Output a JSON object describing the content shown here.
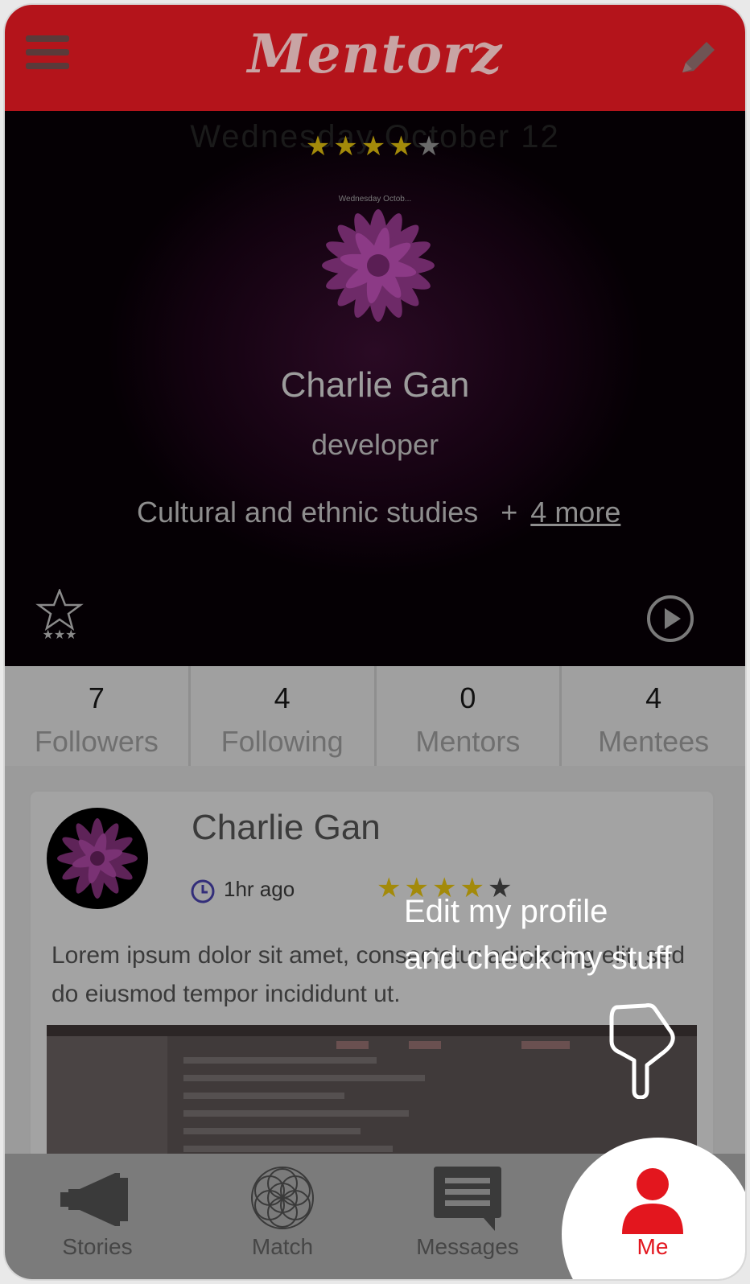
{
  "header": {
    "app_title": "Mentorz"
  },
  "hero": {
    "date_ghost": "Wednesday October 12",
    "stars": [
      "★",
      "★",
      "★",
      "★",
      "★"
    ],
    "avatar_caption": "Wednesday Octob...",
    "name": "Charlie Gan",
    "role": "developer",
    "interest": "Cultural and ethnic studies",
    "more_prefix": "+",
    "more_link": "4 more"
  },
  "stats": [
    {
      "value": "7",
      "label": "Followers"
    },
    {
      "value": "4",
      "label": "Following"
    },
    {
      "value": "0",
      "label": "Mentors"
    },
    {
      "value": "4",
      "label": "Mentees"
    }
  ],
  "post": {
    "author": "Charlie Gan",
    "time": "1hr ago",
    "rating_stars": 4,
    "stars": [
      "★",
      "★",
      "★",
      "★",
      "★"
    ],
    "text": "Lorem ipsum dolor sit amet, consectetur adipiscing elit, sed do eiusmod tempor incididunt ut."
  },
  "tutorial": {
    "line1": "Edit my profile",
    "line2": "and check my stuff"
  },
  "tabs": [
    {
      "label": "Stories",
      "icon": "megaphone-icon"
    },
    {
      "label": "Match",
      "icon": "flower-of-life-icon"
    },
    {
      "label": "Messages",
      "icon": "message-icon"
    },
    {
      "label": "Me",
      "icon": "person-icon"
    }
  ],
  "colors": {
    "brand": "#b4141b",
    "accent_active": "#e3161e",
    "star_gold": "#e0b400"
  }
}
